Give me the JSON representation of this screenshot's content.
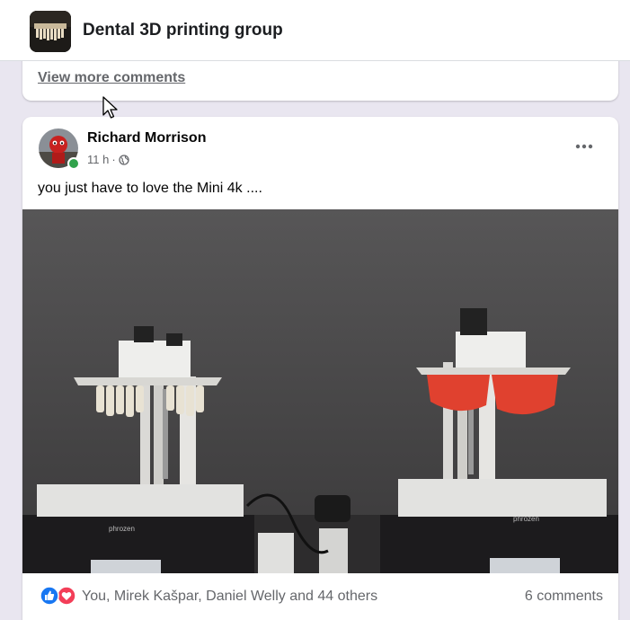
{
  "group": {
    "name": "Dental 3D printing group"
  },
  "comments_card": {
    "view_more": "View more comments"
  },
  "post": {
    "author": "Richard Morrison",
    "time": "11 h",
    "separator": "·",
    "audience_icon": "globe-icon",
    "text": "you just have to love the Mini 4k ....",
    "photo": {
      "brand_left": "phrozen",
      "brand_right": "phrozen"
    },
    "reactions": {
      "icons": [
        "like-icon",
        "love-icon"
      ],
      "summary": "You, Mirek Kašpar, Daniel Welly and 44 others"
    },
    "comments": "6 comments"
  },
  "colors": {
    "like": "#1877f2",
    "love": "#f33e58",
    "online": "#31a24c",
    "muted": "#65676b"
  }
}
